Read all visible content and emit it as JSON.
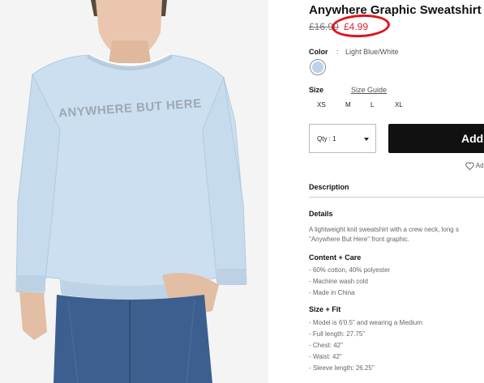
{
  "product": {
    "title": "Anywhere Graphic Sweatshirt",
    "old_price": "£16.90",
    "new_price": "£4.99",
    "print_text": "ANYWHERE BUT HERE"
  },
  "color": {
    "label": "Color",
    "separator": ":",
    "value": "Light Blue/White",
    "swatch_color": "#bcd3ea"
  },
  "size": {
    "label": "Size",
    "guide_link": "Size Guide",
    "options": [
      "XS",
      "M",
      "L",
      "XL"
    ]
  },
  "quantity": {
    "label": "Qty : 1"
  },
  "cart": {
    "add_label": "Add"
  },
  "wishlist": {
    "label": "Ad"
  },
  "description": {
    "tab": "Description",
    "details_title": "Details",
    "details_lines": [
      "A lightweight knit sweatshirt with a crew neck, long s",
      "\"Anywhere But Here\" front graphic."
    ],
    "content_title": "Content + Care",
    "content_lines": [
      "- 60% cotton, 40% polyester",
      "- Machine wash cold",
      "- Made in China"
    ],
    "fit_title": "Size + Fit",
    "fit_lines": [
      "- Model is 6'0.5\" and wearing a Medium",
      "- Full length: 27.75\"",
      "- Chest: 42\"",
      "- Waist: 42\"",
      "- Sleeve length: 26.25\""
    ]
  },
  "colors": {
    "accent_red": "#d4272f",
    "highlight": "#e0141c",
    "button": "#111111"
  }
}
